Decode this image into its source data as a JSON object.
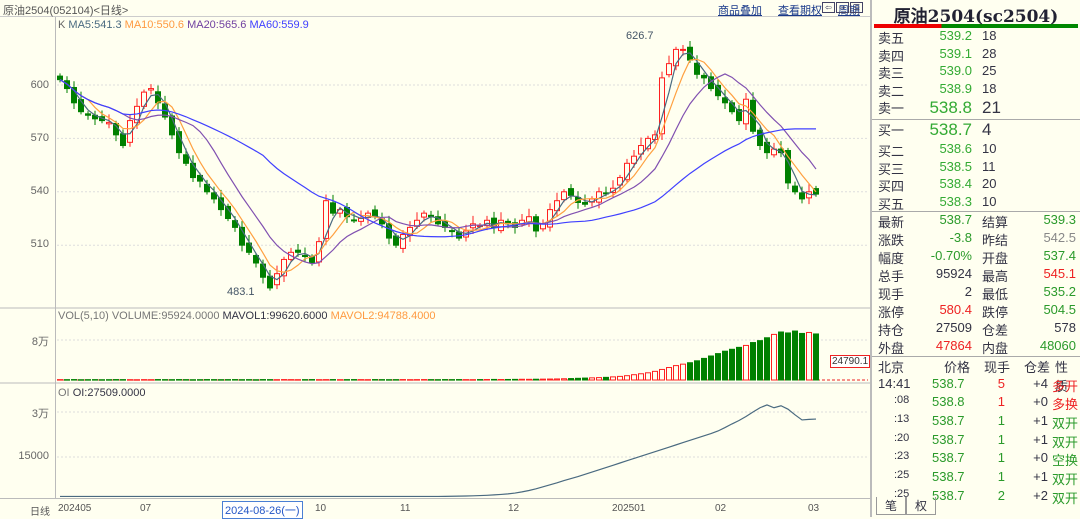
{
  "title": "原油2504(052104)<日线>",
  "links": [
    "商品叠加",
    "查看期权",
    "周期"
  ],
  "main_legend": {
    "k": "K",
    "ma5": "MA5:541.3",
    "ma10": "MA10:550.6",
    "ma20": "MA20:565.6",
    "ma60": "MA60:559.9"
  },
  "vol_legend": {
    "name": "VOL(5,10)",
    "volume": "VOLUME:95924.0000",
    "mavol1": "MAVOL1:99620.6000",
    "mavol2": "MAVOL2:94788.4000",
    "marker": "24790.1"
  },
  "oi_legend": {
    "name": "OI",
    "oi": "OI:27509.0000"
  },
  "axis": {
    "price": [
      "600",
      "570",
      "540",
      "510"
    ],
    "vol": [
      "8万"
    ],
    "oi": [
      "3万",
      "15000"
    ],
    "x_label": "日线",
    "x": [
      "202405",
      "07",
      "10",
      "11",
      "12",
      "202501",
      "02",
      "03"
    ],
    "cursor_date": "2024-08-26(一)",
    "high_label": "626.7",
    "low_label": "483.1"
  },
  "colors": {
    "up": "#ff2020",
    "down": "#008000",
    "ma5": "#4a6a80",
    "ma10": "#ffa040",
    "ma20": "#8050b0",
    "ma60": "#4040ff"
  },
  "chart_data": {
    "type": "candlestick",
    "price_range": [
      470,
      630
    ],
    "closes": [
      603,
      598,
      590,
      585,
      583,
      581,
      580,
      579,
      572,
      566,
      580,
      588,
      596,
      598,
      590,
      582,
      572,
      562,
      556,
      548,
      546,
      540,
      536,
      530,
      525,
      520,
      510,
      506,
      500,
      492,
      486,
      494,
      502,
      506,
      506,
      504,
      500,
      512,
      535,
      528,
      530,
      526,
      524,
      525,
      528,
      526,
      522,
      514,
      510,
      516,
      520,
      524,
      528,
      526,
      522,
      520,
      518,
      514,
      518,
      522,
      521,
      524,
      520,
      524,
      522,
      520,
      524,
      526,
      518,
      522,
      530,
      535,
      540,
      538,
      534,
      533,
      536,
      540,
      539,
      542,
      548,
      556,
      560,
      566,
      570,
      572,
      604,
      612,
      620,
      620,
      614,
      606,
      604,
      598,
      594,
      590,
      585,
      580,
      592,
      574,
      566,
      562,
      564,
      562,
      545,
      540,
      536,
      540,
      538.7
    ],
    "volume": [
      800,
      700,
      900,
      600,
      700,
      800,
      600,
      700,
      900,
      800,
      700,
      600,
      800,
      700,
      900,
      800,
      700,
      900,
      800,
      600,
      700,
      900,
      800,
      700,
      800,
      900,
      700,
      800,
      600,
      900,
      800,
      700,
      900,
      800,
      700,
      800,
      900,
      700,
      800,
      900,
      700,
      800,
      900,
      800,
      700,
      900,
      800,
      700,
      800,
      900,
      700,
      800,
      900,
      800,
      700,
      900,
      800,
      900,
      800,
      700,
      900,
      1000,
      1200,
      1000,
      1100,
      1300,
      1500,
      1400,
      1600,
      1800,
      2000,
      2200,
      2600,
      3000,
      3500,
      4000,
      4500,
      5000,
      5500,
      6500,
      7500,
      9000,
      11000,
      13000,
      15000,
      18000,
      22000,
      26000,
      30000,
      33000,
      36000,
      40000,
      45000,
      50000,
      55000,
      60000,
      64000,
      68000,
      72000,
      78000,
      82000,
      88000,
      95000,
      100000,
      98000,
      102000,
      97000,
      99000,
      95924
    ],
    "oi": [
      200,
      200,
      200,
      200,
      200,
      200,
      200,
      200,
      200,
      200,
      200,
      200,
      200,
      200,
      200,
      200,
      200,
      200,
      200,
      200,
      200,
      200,
      200,
      200,
      200,
      200,
      200,
      200,
      200,
      200,
      200,
      200,
      200,
      200,
      200,
      200,
      200,
      200,
      200,
      200,
      200,
      200,
      200,
      200,
      200,
      200,
      200,
      200,
      200,
      200,
      200,
      200,
      200,
      200,
      200,
      220,
      260,
      300,
      350,
      420,
      500,
      600,
      750,
      900,
      1100,
      1400,
      1800,
      2300,
      2900,
      3600,
      4300,
      5000,
      5800,
      6500,
      7200,
      8000,
      8800,
      9600,
      10400,
      11200,
      12000,
      12800,
      13600,
      14400,
      15200,
      16000,
      16800,
      17600,
      18400,
      19200,
      20000,
      20800,
      21600,
      22400,
      23300,
      24500,
      25800,
      27000,
      28400,
      30000,
      31500,
      32500,
      31500,
      32200,
      31000,
      29000,
      27200,
      27400,
      27509
    ]
  },
  "panel": {
    "title": "原油2504(sc2504)",
    "asks": [
      {
        "l": "卖五",
        "p": "539.2",
        "v": "18"
      },
      {
        "l": "卖四",
        "p": "539.1",
        "v": "28"
      },
      {
        "l": "卖三",
        "p": "539.0",
        "v": "25"
      },
      {
        "l": "卖二",
        "p": "538.9",
        "v": "18"
      },
      {
        "l": "卖一",
        "p": "538.8",
        "v": "21"
      }
    ],
    "bids": [
      {
        "l": "买一",
        "p": "538.7",
        "v": "4"
      },
      {
        "l": "买二",
        "p": "538.6",
        "v": "10"
      },
      {
        "l": "买三",
        "p": "538.5",
        "v": "11"
      },
      {
        "l": "买四",
        "p": "538.4",
        "v": "20"
      },
      {
        "l": "买五",
        "p": "538.3",
        "v": "10"
      }
    ],
    "quote": [
      [
        "最新",
        "538.7",
        "结算",
        "539.3"
      ],
      [
        "涨跌",
        "-3.8",
        "昨结",
        "542.5"
      ],
      [
        "幅度",
        "-0.70%",
        "开盘",
        "537.4"
      ],
      [
        "总手",
        "95924",
        "最高",
        "545.1"
      ],
      [
        "现手",
        "2",
        "最低",
        "535.2"
      ],
      [
        "涨停",
        "580.4",
        "跌停",
        "504.5"
      ],
      [
        "持仓",
        "27509",
        "仓差",
        "578"
      ],
      [
        "外盘",
        "47864",
        "内盘",
        "48060"
      ]
    ],
    "trade_headers": [
      "北京",
      "价格",
      "现手",
      "仓差",
      "性质"
    ],
    "trades": [
      [
        "14:41",
        "538.7",
        "5",
        "+4",
        "多开"
      ],
      [
        ":08",
        "538.8",
        "1",
        "+0",
        "多换"
      ],
      [
        ":13",
        "538.7",
        "1",
        "+1",
        "双开"
      ],
      [
        ":20",
        "538.7",
        "1",
        "+1",
        "双开"
      ],
      [
        ":23",
        "538.7",
        "1",
        "+0",
        "空换"
      ],
      [
        ":25",
        "538.7",
        "1",
        "+1",
        "双开"
      ],
      [
        ":25",
        "538.7",
        "2",
        "+2",
        "双开"
      ]
    ],
    "tabs": [
      "笔",
      "权"
    ]
  }
}
